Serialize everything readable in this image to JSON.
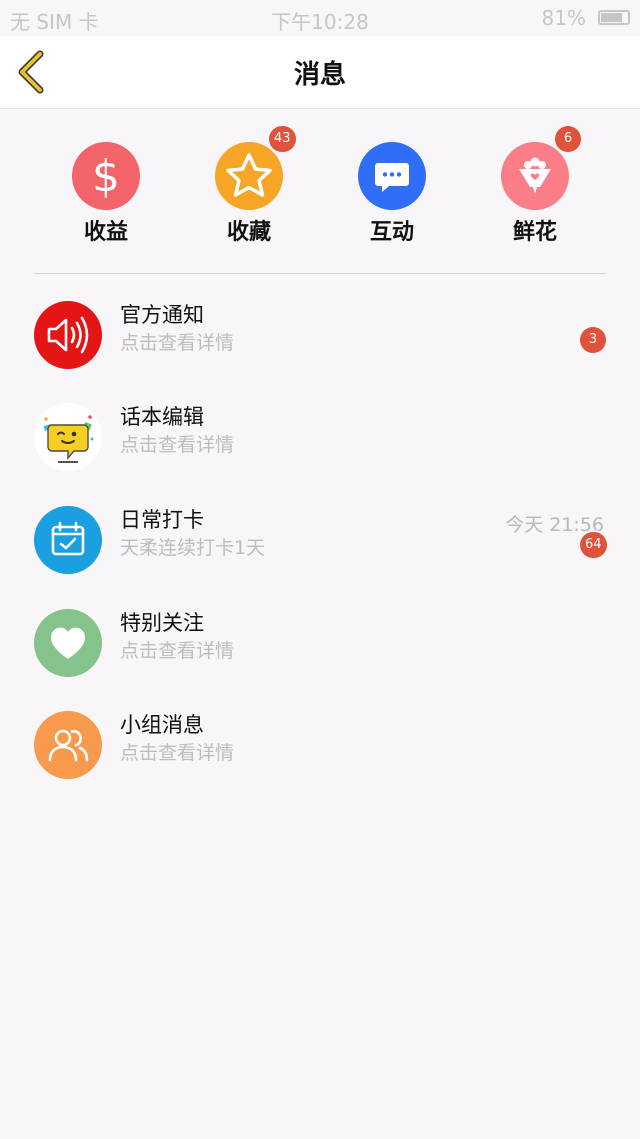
{
  "status_bar": {
    "carrier": "无 SIM 卡",
    "time": "下午10:28",
    "battery": "81%",
    "battery_level": 0.81
  },
  "nav": {
    "title": "消息",
    "back_icon": "chevron-left-icon"
  },
  "quick_actions": [
    {
      "label": "收益",
      "icon": "dollar-icon",
      "color": "#f2636a",
      "badge": ""
    },
    {
      "label": "收藏",
      "icon": "star-icon",
      "color": "#f6a526",
      "badge": "43"
    },
    {
      "label": "互动",
      "icon": "chat-bubble-icon",
      "color": "#2f6ef6",
      "badge": ""
    },
    {
      "label": "鲜花",
      "icon": "flower-icon",
      "color": "#fa7d87",
      "badge": "6"
    }
  ],
  "messages": [
    {
      "title": "官方通知",
      "subtitle": "点击查看详情",
      "time": "",
      "badge": "3",
      "icon": "speaker-icon",
      "color": "#e51515"
    },
    {
      "title": "话本编辑",
      "subtitle": "点击查看详情",
      "time": "",
      "badge": "",
      "icon": "editor-avatar-icon",
      "color": "#ffffff"
    },
    {
      "title": "日常打卡",
      "subtitle": "天柔连续打卡1天",
      "time": "今天 21:56",
      "badge": "64",
      "icon": "calendar-check-icon",
      "color": "#1a9fe0"
    },
    {
      "title": "特别关注",
      "subtitle": "点击查看详情",
      "time": "",
      "badge": "",
      "icon": "heart-icon",
      "color": "#86c28c"
    },
    {
      "title": "小组消息",
      "subtitle": "点击查看详情",
      "time": "",
      "badge": "",
      "icon": "group-icon",
      "color": "#f79a4d"
    }
  ],
  "colors": {
    "badge": "#e0523a",
    "back_icon": "#e4c12d"
  }
}
